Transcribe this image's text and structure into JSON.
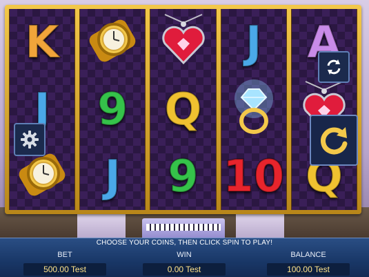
{
  "reels": [
    [
      {
        "type": "letter",
        "text": "K",
        "color": "#f1a53a"
      },
      {
        "type": "letter",
        "text": "J",
        "color": "#4aa8e8"
      },
      {
        "type": "icon",
        "icon": "gold-watch-icon"
      }
    ],
    [
      {
        "type": "icon",
        "icon": "gold-watch-icon"
      },
      {
        "type": "letter",
        "text": "9",
        "color": "#35c24a"
      },
      {
        "type": "letter",
        "text": "J",
        "color": "#4aa8e8"
      }
    ],
    [
      {
        "type": "icon",
        "icon": "heart-pendant-icon"
      },
      {
        "type": "letter",
        "text": "Q",
        "color": "#efc130"
      },
      {
        "type": "letter",
        "text": "9",
        "color": "#35c24a"
      }
    ],
    [
      {
        "type": "letter",
        "text": "J",
        "color": "#4aa8e8"
      },
      {
        "type": "icon",
        "icon": "diamond-ring-icon"
      },
      {
        "type": "letter",
        "text": "10",
        "color": "#e8242c"
      }
    ],
    [
      {
        "type": "letter",
        "text": "A",
        "color": "#c98be8"
      },
      {
        "type": "icon",
        "icon": "heart-pendant-icon"
      },
      {
        "type": "letter",
        "text": "Q",
        "color": "#efc130"
      }
    ]
  ],
  "message": "CHOOSE YOUR COINS, THEN CLICK SPIN TO PLAY!",
  "stats": {
    "bet": {
      "label": "BET",
      "value": "500.00 Test"
    },
    "win": {
      "label": "WIN",
      "value": "0.00 Test"
    },
    "balance": {
      "label": "BALANCE",
      "value": "100.00 Test"
    }
  },
  "buttons": {
    "refresh_icon": "refresh-icon",
    "spin_icon": "spin-arrow-icon",
    "settings_icon": "gear-icon"
  }
}
